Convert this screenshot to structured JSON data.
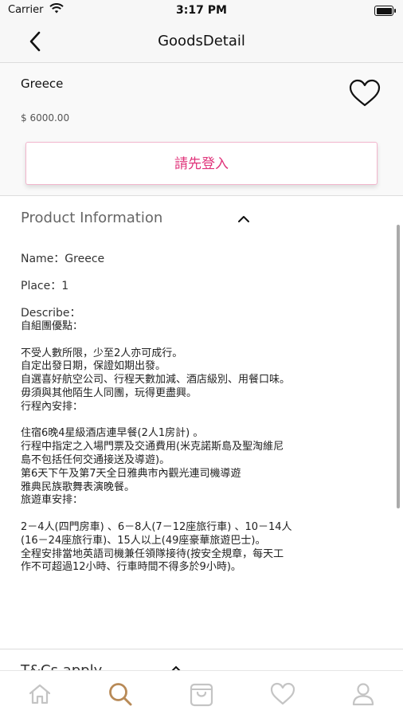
{
  "status_bar": {
    "carrier": "Carrier",
    "time": "3:17 PM"
  },
  "nav": {
    "title": "GoodsDetail",
    "back_icon": "chevron-left-icon"
  },
  "goods": {
    "name": "Greece",
    "price": "$ 6000.00",
    "favorite_icon": "heart-outline-icon"
  },
  "login_button": {
    "label": "請先登入"
  },
  "product_info": {
    "title": "Product Information",
    "name_line": "Name：Greece",
    "place_line": "Place：1",
    "describe_label": "Describe：",
    "describe_body": "自組團優點：\n\n不受人數所限，少至2人亦可成行。\n自定出發日期，保證如期出發。\n自選喜好航空公司、行程天數加減、酒店級別、用餐口味。\n毋須與其他陌生人同團，玩得更盡興。\n行程內安排：\n\n住宿6晚4星級酒店連早餐(2人1房計) 。\n行程中指定之入場門票及交通費用(米克諾斯島及聖淘維尼\n島不包括任何交通接送及導遊)。\n第6天下午及第7天全日雅典市內觀光連司機導遊\n雅典民族歌舞表演晚餐。\n旅遊車安排：\n\n2－4人(四門房車) 、6－8人(7－12座旅行車) 、10－14人\n(16－24座旅行車)、15人以上(49座豪華旅遊巴士)。\n全程安排當地英語司機兼任領隊接待(按安全規章，每天工\n作不可超過12小時、行車時間不得多於9小時)。"
  },
  "tc_section": {
    "title": "T&Cs apply"
  },
  "tab_bar": {
    "items": [
      {
        "icon": "home-icon",
        "active": false
      },
      {
        "icon": "search-icon",
        "active": true
      },
      {
        "icon": "shopping-bag-icon",
        "active": false
      },
      {
        "icon": "heart-icon",
        "active": false
      },
      {
        "icon": "user-icon",
        "active": false
      }
    ],
    "active_color": "#b88a57",
    "inactive_color": "#c4c4c4"
  },
  "colors": {
    "accent_pink": "#e0337a",
    "border_pink": "#f2b6cd"
  }
}
